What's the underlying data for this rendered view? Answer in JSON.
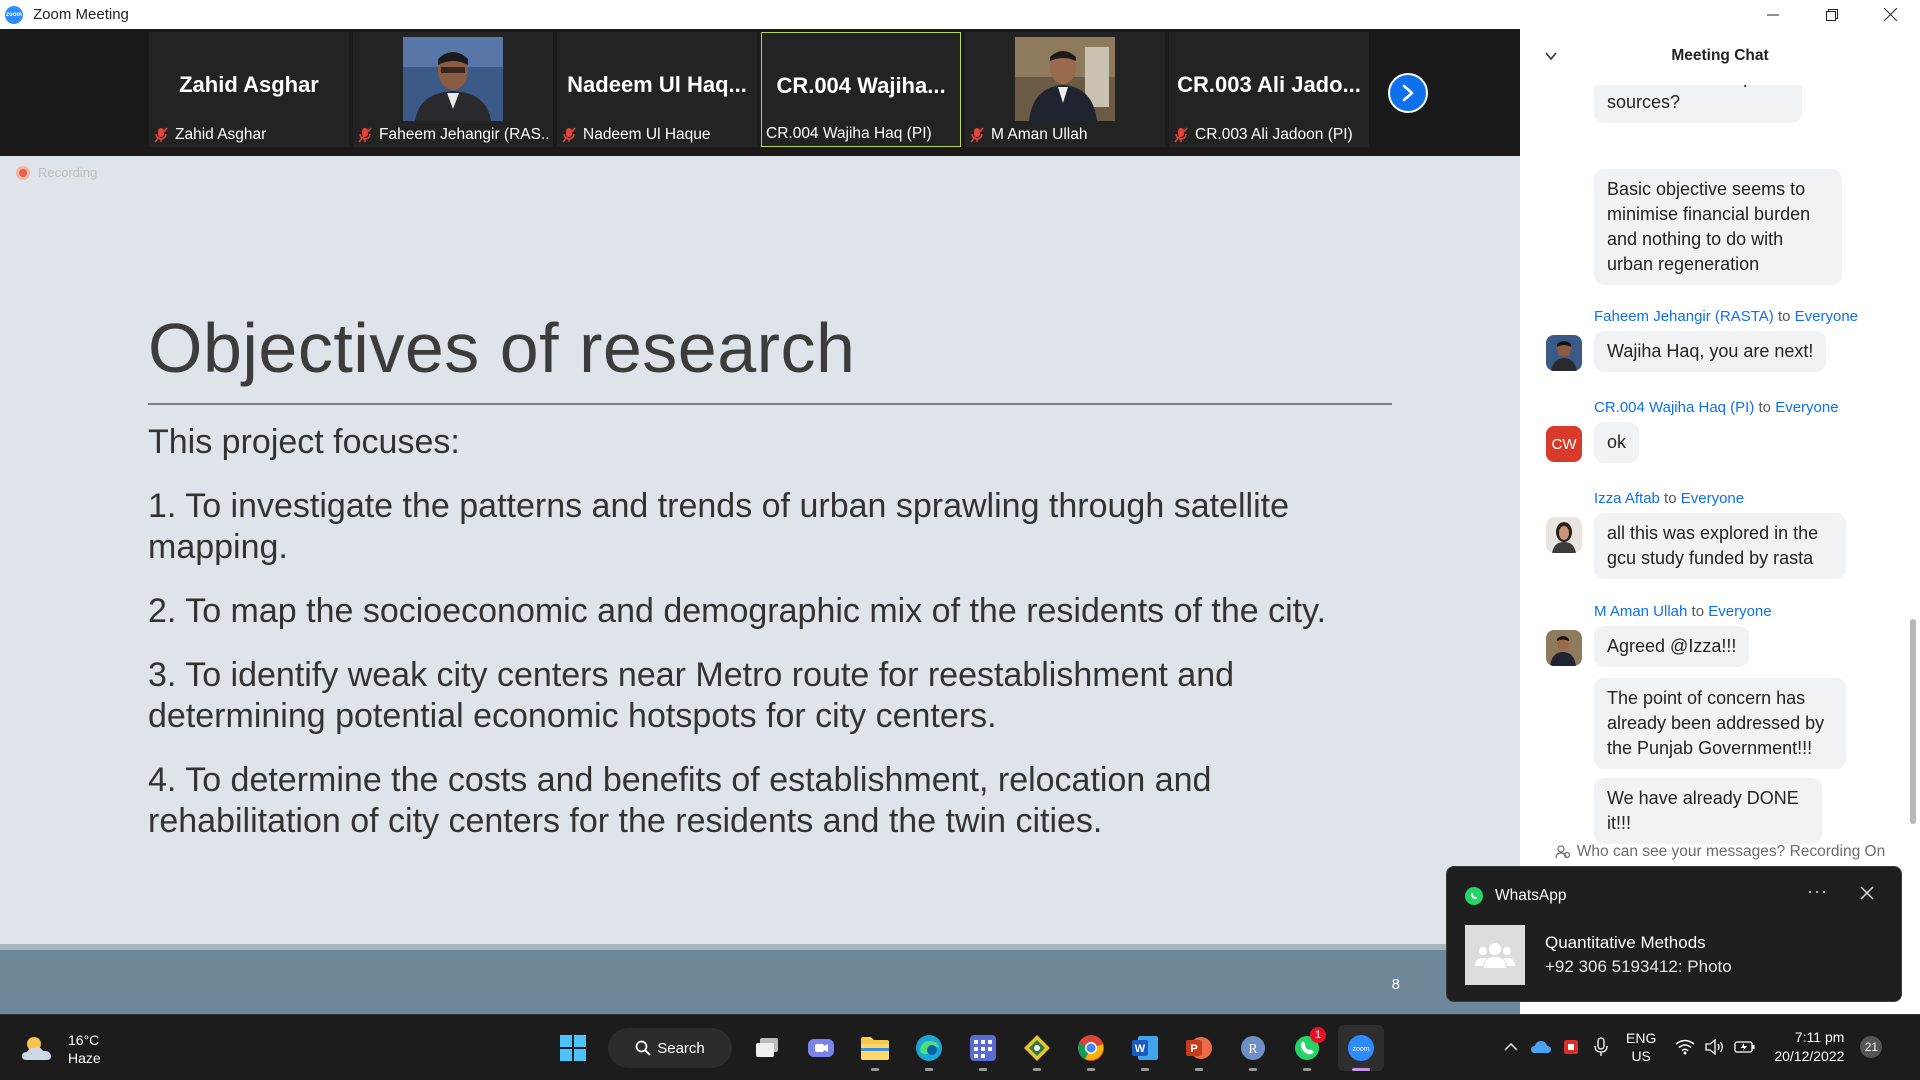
{
  "window": {
    "title": "Zoom Meeting",
    "app_icon": "zoom"
  },
  "participants": [
    {
      "big_name": "Zahid Asghar",
      "label": "Zahid Asghar",
      "has_photo": false,
      "muted": true,
      "active": false
    },
    {
      "big_name": "",
      "label": "Faheem Jehangir (RAS...",
      "has_photo": true,
      "muted": true,
      "active": false
    },
    {
      "big_name": "Nadeem Ul Haq...",
      "label": "Nadeem Ul Haque",
      "has_photo": false,
      "muted": true,
      "active": false
    },
    {
      "big_name": "CR.004 Wajiha...",
      "label": "CR.004 Wajiha Haq (PI)",
      "has_photo": false,
      "muted": false,
      "active": true
    },
    {
      "big_name": "",
      "label": "M Aman Ullah",
      "has_photo": true,
      "muted": true,
      "active": false
    },
    {
      "big_name": "CR.003 Ali Jado...",
      "label": "CR.003 Ali Jadoon (PI)",
      "has_photo": false,
      "muted": true,
      "active": false
    }
  ],
  "recording": {
    "label": "Recording"
  },
  "slide": {
    "title": "Objectives of research",
    "intro": "This project focuses:",
    "items": [
      "1. To investigate the patterns and trends of urban sprawling through satellite mapping.",
      "2. To map the socioeconomic and demographic mix of the residents of the city.",
      "3.  To identify weak city centers near Metro route for reestablishment and determining potential economic hotspots for city centers.",
      "4.  To determine the costs and benefits of establishment, relocation and rehabilitation of city centers for the residents and the twin cities."
    ],
    "page_number": "8"
  },
  "chat": {
    "title": "Meeting Chat",
    "partial_message": "evidence of cheaper sources?",
    "message_1": "Basic objective seems to minimise financial burden and nothing to do with urban regeneration",
    "sender_faheem": "Faheem Jehangir (RASTA)",
    "to": "to",
    "everyone": "Everyone",
    "message_faheem": "Wajiha Haq, you are next!",
    "sender_wajiha": "CR.004 Wajiha Haq (PI)",
    "wajiha_initials": "CW",
    "message_wajiha": "ok",
    "sender_izza": "Izza Aftab",
    "message_izza": "all this was explored in the gcu study funded by rasta",
    "sender_aman": "M Aman Ullah",
    "message_aman_1": "Agreed @Izza!!!",
    "message_aman_2": "The point of concern has already been addressed by the Punjab Government!!!",
    "message_aman_3": "We have  already DONE it!!!",
    "footer": "Who can see your messages? Recording On"
  },
  "notification": {
    "app": "WhatsApp",
    "group": "Quantitative Methods",
    "message": "+92 306 5193412: Photo",
    "more": "···"
  },
  "taskbar": {
    "weather_temp": "16°C",
    "weather_desc": "Haze",
    "search_label": "Search",
    "whatsapp_badge": "1",
    "lang_1": "ENG",
    "lang_2": "US",
    "time": "7:11 pm",
    "date": "20/12/2022",
    "notification_count": "21"
  },
  "colors": {
    "zoom_blue": "#0E71EB",
    "chat_link": "#0E71EB",
    "slide_bg": "#dfe3ea",
    "slide_footer": "#6e8799",
    "active_tile_border": "#b8d35a"
  }
}
